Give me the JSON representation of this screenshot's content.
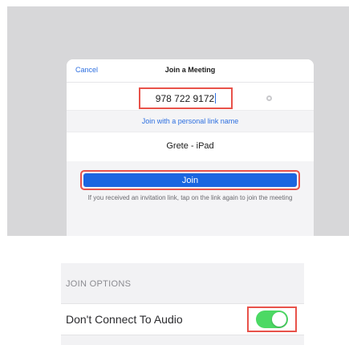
{
  "join_dialog": {
    "cancel_label": "Cancel",
    "title": "Join a Meeting",
    "meeting_id_value": "978 722 9172",
    "personal_link_label": "Join with a personal link name",
    "screen_name": "Grete - iPad",
    "join_label": "Join",
    "hint_text": "If you received an invitation link, tap on the link again to join the meeting"
  },
  "join_options": {
    "header": "JOIN OPTIONS",
    "items": [
      {
        "label": "Don't Connect To Audio",
        "enabled": true
      }
    ]
  },
  "colors": {
    "accent_blue": "#1b66e0",
    "link_blue": "#2d6fe0",
    "highlight_red": "#e8524a",
    "toggle_on_green": "#4cd964"
  },
  "icons": {
    "clear": "clear-circle-icon",
    "cursor": "text-cursor"
  }
}
